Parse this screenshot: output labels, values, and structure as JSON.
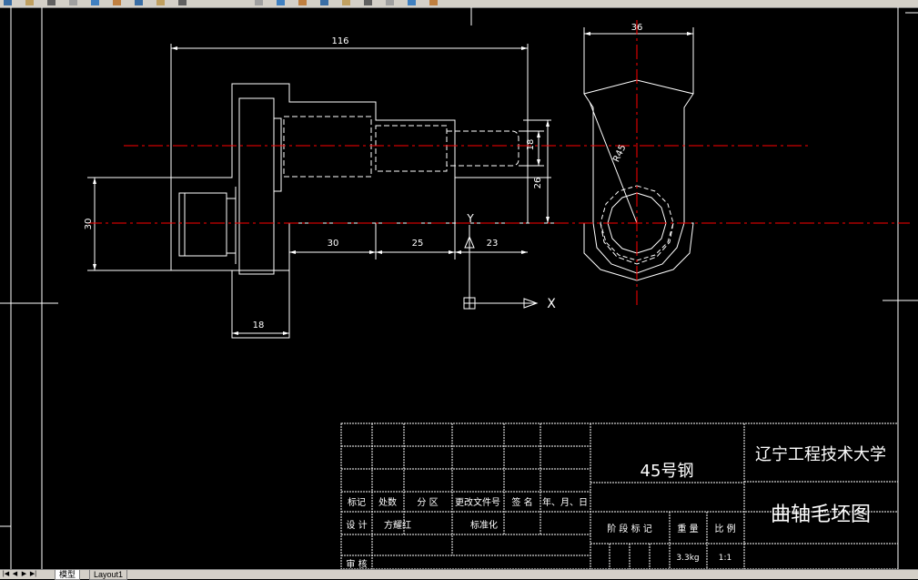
{
  "toolbar": {
    "icons": [
      "open-icon",
      "save-icon",
      "print-icon",
      "cut-icon",
      "copy-icon",
      "paste-icon",
      "match-properties-icon",
      "undo-icon",
      "redo-icon",
      "pan-icon",
      "zoom-icon",
      "zoom-window-icon",
      "zoom-previous-icon",
      "properties-icon",
      "design-center-icon",
      "tool-palettes-icon",
      "layer-icon",
      "color-icon"
    ]
  },
  "drawing": {
    "colors": {
      "lines": "#ffffff",
      "centerline": "#ff0000",
      "background": "#000000",
      "ucs": "#ffffff"
    },
    "dimensions": {
      "overall_length": "116",
      "width_36": "36",
      "dia_30": "30",
      "len_30": "30",
      "len_25": "25",
      "len_23": "23",
      "len_18": "18",
      "dia_18": "18",
      "offset_26": "26",
      "radius": "R45"
    },
    "ucs": {
      "x_label": "X",
      "y_label": "Y"
    }
  },
  "title_block": {
    "material": "45号钢",
    "university": "辽宁工程技术大学",
    "drawing_name": "曲轴毛坯图",
    "revision_headers": [
      "标记",
      "处数",
      "分 区",
      "更改文件号",
      "签 名",
      "年、月、日"
    ],
    "design_row": [
      "设 计",
      "方耀红",
      "",
      "标准化"
    ],
    "review_row": [
      "审 核"
    ],
    "stage_headers": [
      "阶 段 标 记",
      "重 量",
      "比 例"
    ],
    "weight": "3.3kg",
    "scale": "1:1"
  },
  "tabs": {
    "model": "模型",
    "layout": "Layout1"
  }
}
